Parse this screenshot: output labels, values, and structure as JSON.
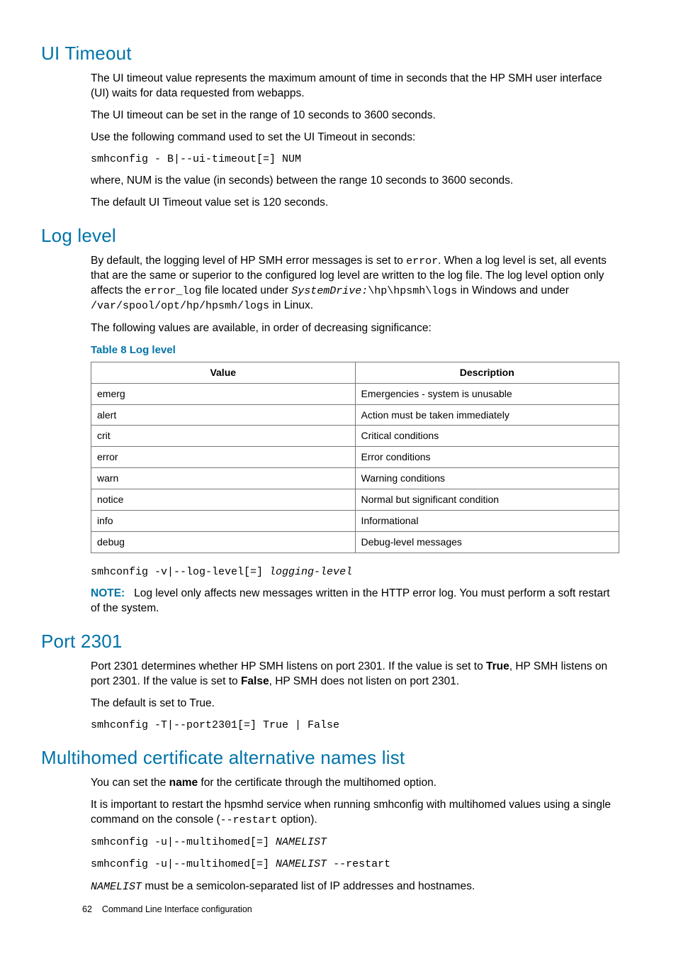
{
  "sections": {
    "uiTimeout": {
      "heading": "UI Timeout",
      "p1": "The UI timeout value represents the maximum amount of time in seconds that the HP SMH user interface (UI) waits for data requested from webapps.",
      "p2": "The UI timeout can be set in the range of 10 seconds to 3600 seconds.",
      "p3": "Use the following command used to set the UI Timeout in seconds:",
      "code1": "smhconfig - B|--ui-timeout[=] NUM",
      "p4": "where, NUM is the value (in seconds) between the range 10 seconds to 3600 seconds.",
      "p5": "The default UI Timeout value set is 120 seconds."
    },
    "logLevel": {
      "heading": "Log level",
      "p1a": "By default, the logging level of HP SMH error messages is set to ",
      "p1b": "error",
      "p1c": ". When a log level is set, all events that are the same or superior to the configured log level are written to the log file. The log level option only affects the ",
      "p1d": "error_log",
      "p1e": " file located under  ",
      "p1f": "SystemDrive:",
      "p1g": "\\hp\\hpsmh\\logs",
      "p1h": " in Windows and under ",
      "p1i": "/var/spool/opt/hp/hpsmh/logs",
      "p1j": " in Linux.",
      "p2": "The following values are available, in order of decreasing significance:",
      "tableCaption": "Table 8 Log level",
      "th1": "Value",
      "th2": "Description",
      "rows": [
        {
          "v": "emerg",
          "d": "Emergencies - system is unusable"
        },
        {
          "v": "alert",
          "d": "Action must be taken immediately"
        },
        {
          "v": "crit",
          "d": "Critical conditions"
        },
        {
          "v": "error",
          "d": "Error conditions"
        },
        {
          "v": "warn",
          "d": "Warning conditions"
        },
        {
          "v": "notice",
          "d": "Normal but significant condition"
        },
        {
          "v": "info",
          "d": "Informational"
        },
        {
          "v": "debug",
          "d": "Debug-level messages"
        }
      ],
      "code1a": "smhconfig -v|--log-level[=] ",
      "code1b": "logging-level",
      "noteLabel": "NOTE:",
      "noteText": "Log level only affects new messages written in the HTTP error log. You must perform a soft restart of the system."
    },
    "port2301": {
      "heading": "Port 2301",
      "p1a": "Port 2301 determines whether HP SMH listens on port 2301. If the value is set to ",
      "p1b": "True",
      "p1c": ", HP SMH listens on port 2301. If the value is set to ",
      "p1d": "False",
      "p1e": ", HP SMH does not listen on port 2301.",
      "p2": "The default is set to True.",
      "code1": "smhconfig -T|--port2301[=] True | False"
    },
    "multihomed": {
      "heading": "Multihomed certificate alternative names list",
      "p1a": "You can set the ",
      "p1b": "name",
      "p1c": " for the certificate through the multihomed option.",
      "p2a": "It is important to restart the hpsmhd service when running smhconfig with multihomed values using a single command on the console (",
      "p2b": "--restart",
      "p2c": " option).",
      "code1a": "smhconfig -u|--multihomed[=] ",
      "code1b": "NAMELIST",
      "code2a": "smhconfig -u|--multihomed[=] ",
      "code2b": "NAMELIST",
      "code2c": " --restart",
      "p3a": "NAMELIST",
      "p3b": " must be a semicolon-separated list of IP addresses and hostnames."
    }
  },
  "footer": {
    "pageNum": "62",
    "chapter": "Command Line Interface configuration"
  }
}
